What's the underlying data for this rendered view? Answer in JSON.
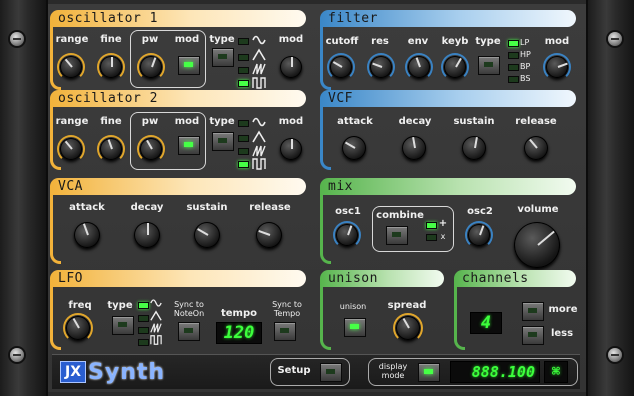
{
  "osc1": {
    "title": "oscillator 1",
    "range": "range",
    "fine": "fine",
    "pw": "pw",
    "mod": "mod",
    "type": "type",
    "mod2": "mod"
  },
  "osc2": {
    "title": "oscillator 2",
    "range": "range",
    "fine": "fine",
    "pw": "pw",
    "mod": "mod",
    "type": "type",
    "mod2": "mod"
  },
  "vca": {
    "title": "VCA",
    "attack": "attack",
    "decay": "decay",
    "sustain": "sustain",
    "release": "release"
  },
  "lfo": {
    "title": "LFO",
    "freq": "freq",
    "type": "type",
    "sync_noteon": "Sync to NoteOn",
    "tempo": "tempo",
    "tempo_value": "120",
    "sync_tempo": "Sync to Tempo"
  },
  "filter": {
    "title": "filter",
    "cutoff": "cutoff",
    "res": "res",
    "env": "env",
    "keyb": "keyb",
    "type": "type",
    "mod": "mod",
    "types": [
      "LP",
      "HP",
      "BP",
      "BS"
    ]
  },
  "vcf": {
    "title": "VCF",
    "attack": "attack",
    "decay": "decay",
    "sustain": "sustain",
    "release": "release"
  },
  "mix": {
    "title": "mix",
    "osc1": "osc1",
    "combine": "combine",
    "plus": "+",
    "times": "x",
    "osc2": "osc2",
    "volume": "volume"
  },
  "unison": {
    "title": "unison",
    "unison": "unison",
    "spread": "spread"
  },
  "channels": {
    "title": "channels",
    "value": "4",
    "more": "more",
    "less": "less"
  },
  "bottom": {
    "logo_jx": "JX",
    "logo_synth": "Synth",
    "setup": "Setup",
    "display_mode": "display mode",
    "display_value": "888.100"
  },
  "colors": {
    "orange": "#f2b23a",
    "blue": "#3a87c8",
    "green": "#56b44c",
    "led": "#46ff46"
  }
}
